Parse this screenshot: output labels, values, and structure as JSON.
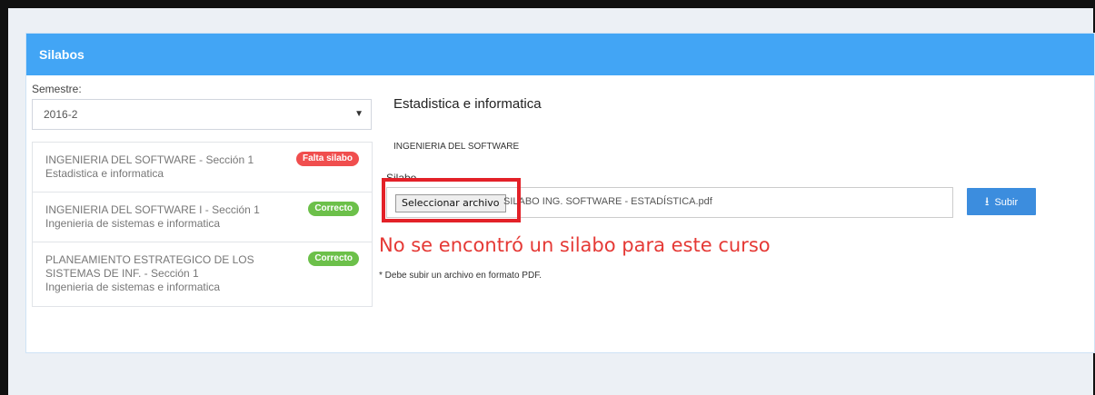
{
  "panel": {
    "title": "Silabos"
  },
  "semester": {
    "label": "Semestre:",
    "value": "2016-2"
  },
  "courses": [
    {
      "title": "INGENIERIA DEL SOFTWARE - Sección 1",
      "subtitle": "Estadistica e informatica",
      "status": "Falta silabo",
      "status_color": "#f04e4e"
    },
    {
      "title": "INGENIERIA DEL SOFTWARE I - Sección 1",
      "subtitle": "Ingenieria de sistemas e informatica",
      "status": "Correcto",
      "status_color": "#6cc04a"
    },
    {
      "title": "PLANEAMIENTO ESTRATEGICO DE LOS SISTEMAS DE INF. - Sección 1",
      "subtitle": "Ingenieria de sistemas e informatica",
      "status": "Correcto",
      "status_color": "#6cc04a"
    }
  ],
  "detail": {
    "course_name": "Estadistica e informatica",
    "course_code": "INGENIERIA DEL SOFTWARE",
    "silabo_label": "Silabo",
    "file_button": "Seleccionar archivo",
    "file_name": "SILABO ING. SOFTWARE - ESTADÍSTICA.pdf",
    "upload_label": "Subir",
    "upload_icon": "upload-icon",
    "error": "No se encontró un silabo para este curso",
    "note": "* Debe subir un archivo en formato PDF."
  },
  "colors": {
    "header": "#42a5f5",
    "upload": "#3c8dde",
    "error": "#e53935",
    "highlight": "#e32128"
  }
}
